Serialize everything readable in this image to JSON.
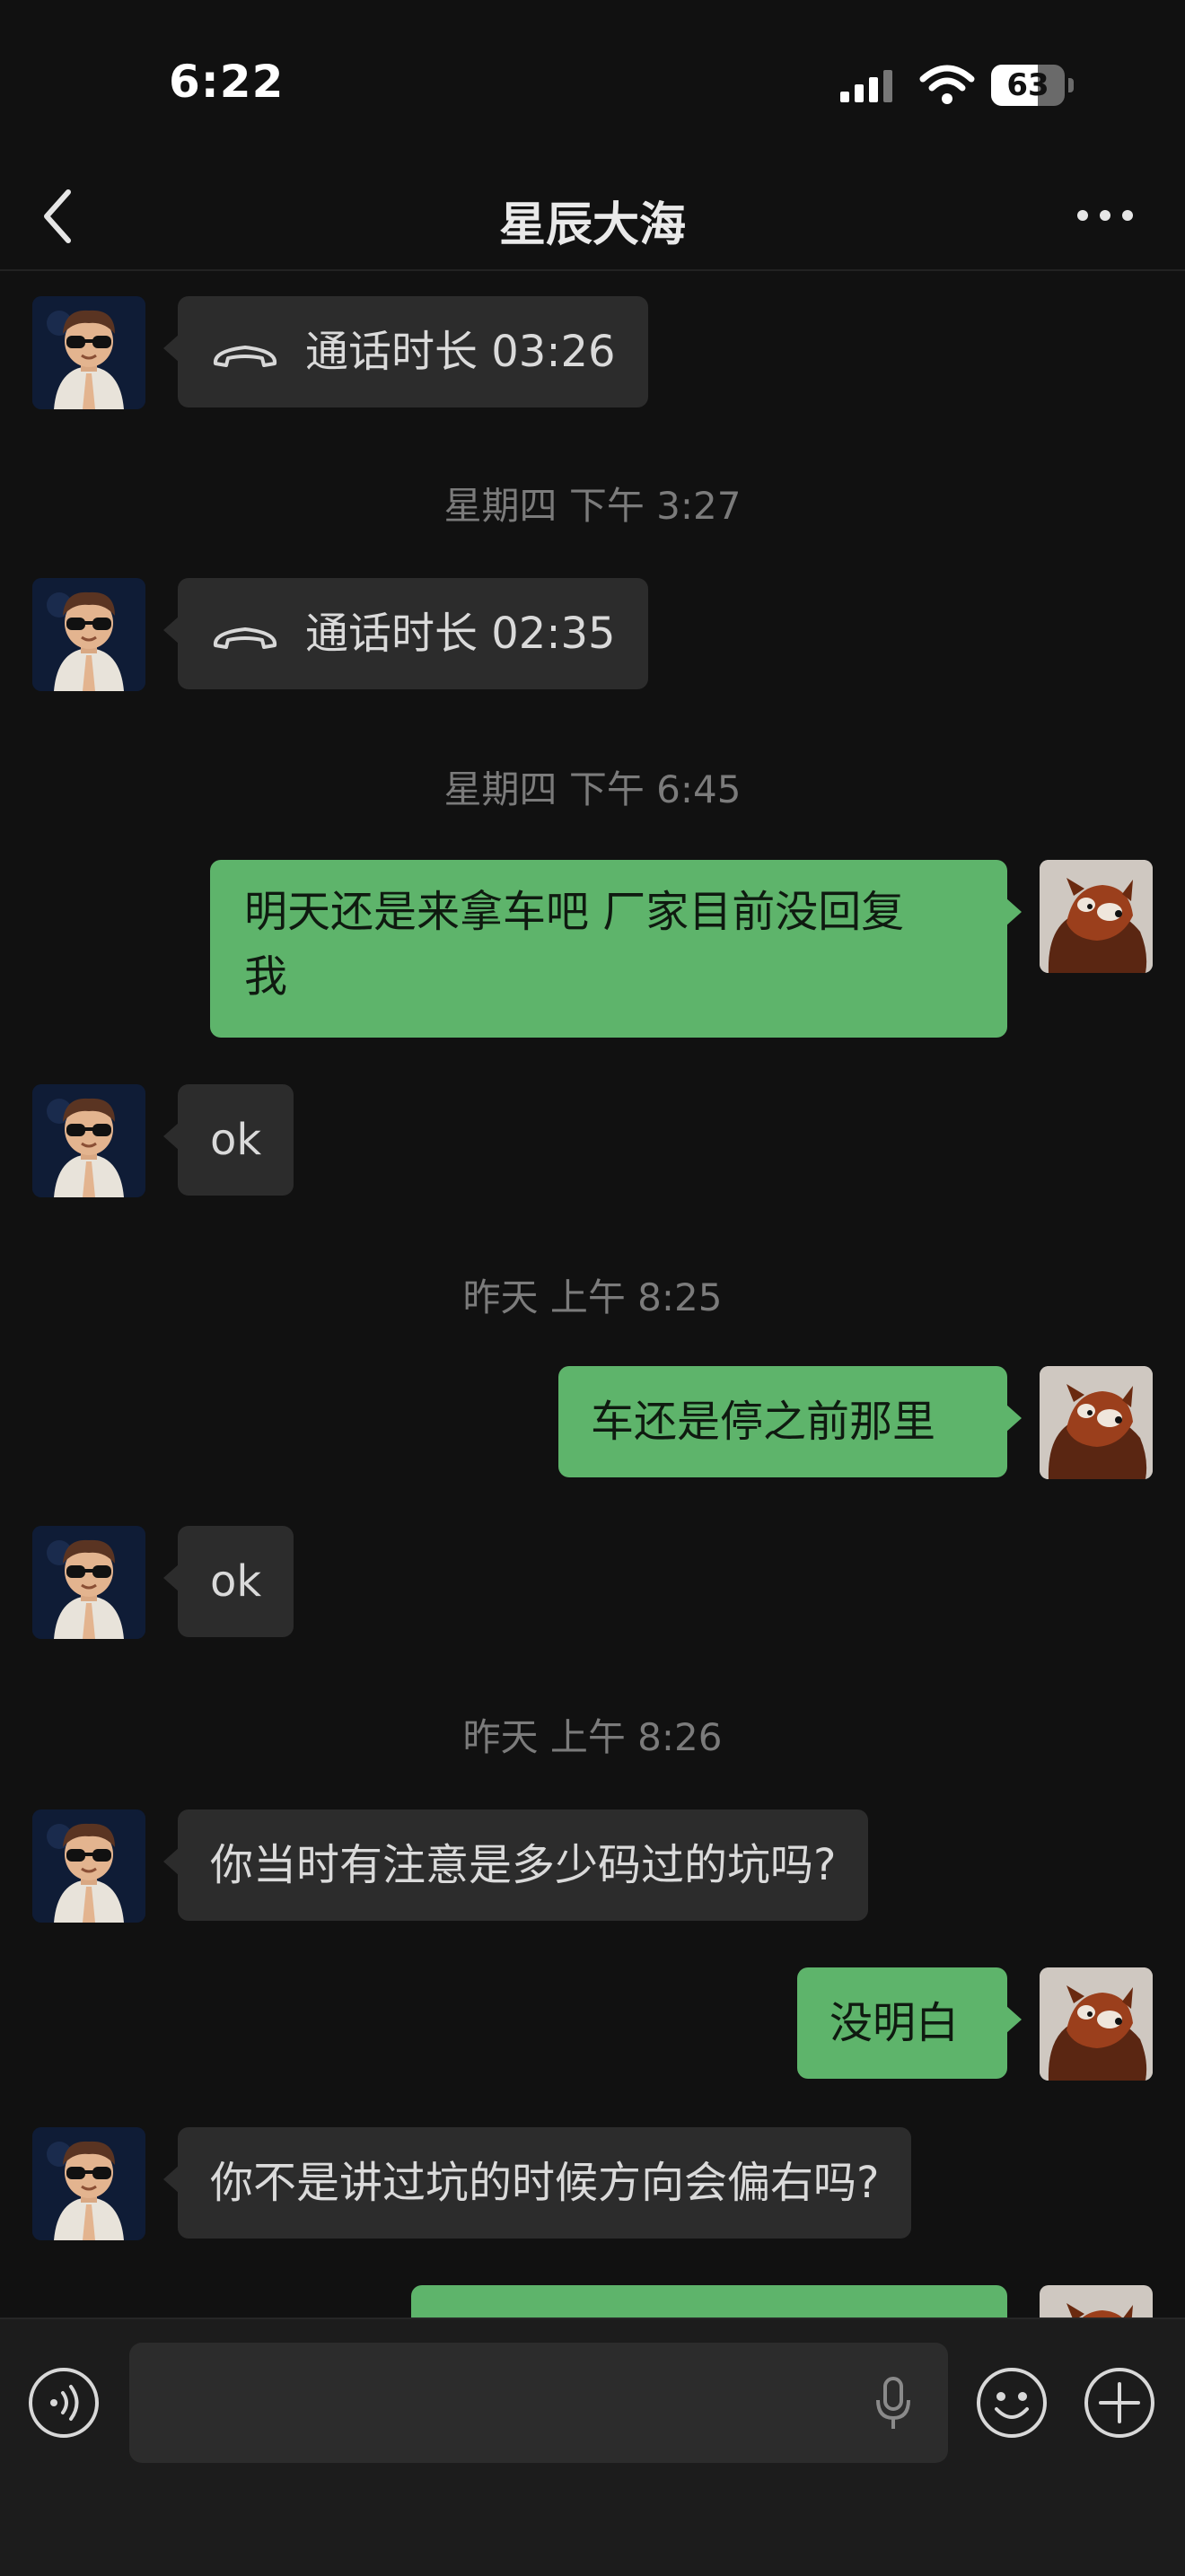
{
  "status_bar": {
    "time": "6:22",
    "battery": "63",
    "battery_level": 0.63
  },
  "nav": {
    "title": "星辰大海"
  },
  "messages": [
    {
      "type": "call",
      "from": "other",
      "text": "通话时长 03:26"
    },
    {
      "type": "timestamp",
      "text": "星期四 下午 3:27"
    },
    {
      "type": "call",
      "from": "other",
      "text": "通话时长 02:35"
    },
    {
      "type": "timestamp",
      "text": "星期四 下午 6:45"
    },
    {
      "type": "text",
      "from": "me",
      "lines": [
        "明天还是来拿车吧 厂家目前没回复",
        "我"
      ]
    },
    {
      "type": "text",
      "from": "other",
      "text": "ok"
    },
    {
      "type": "timestamp",
      "text": "昨天 上午 8:25"
    },
    {
      "type": "text",
      "from": "me",
      "text": "车还是停之前那里"
    },
    {
      "type": "text",
      "from": "other",
      "text": "ok"
    },
    {
      "type": "timestamp",
      "text": "昨天 上午 8:26"
    },
    {
      "type": "text",
      "from": "other",
      "text": "你当时有注意是多少码过的坑吗?"
    },
    {
      "type": "text",
      "from": "me",
      "text": "没明白"
    },
    {
      "type": "text",
      "from": "other",
      "text": "你不是讲过坑的时候方向会偏右吗?"
    }
  ],
  "input": {
    "placeholder": ""
  },
  "icons": {
    "back": "back-chevron-icon",
    "more": "more-icon",
    "voice": "voice-mode-icon",
    "mic": "microphone-icon",
    "emoji": "emoji-icon",
    "plus": "plus-icon",
    "call": "phone-handset-icon"
  },
  "colors": {
    "sent_bubble": "#5eb46b",
    "received_bubble": "#2c2c2c",
    "background": "#111111"
  }
}
